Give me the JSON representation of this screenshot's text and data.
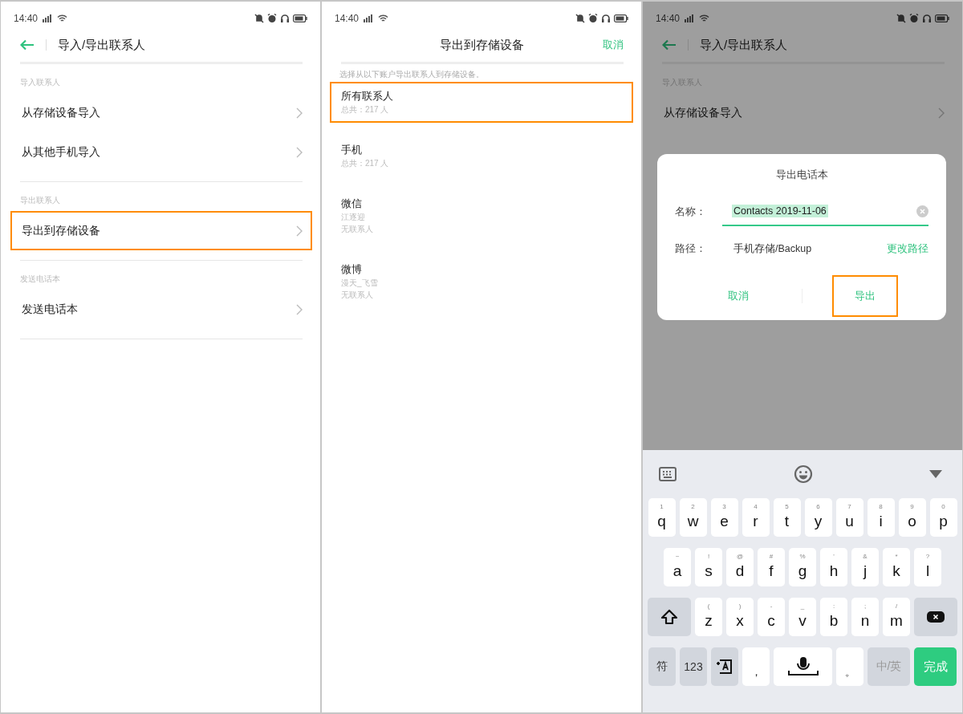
{
  "panels": [
    {
      "kind": "contacts",
      "status_bar": {
        "time": "14:40"
      },
      "header": {
        "title": "导入/导出联系人"
      },
      "sections": [
        {
          "label": "导入联系人",
          "items": [
            {
              "label": "从存储设备导入",
              "highlighted": false
            },
            {
              "label": "从其他手机导入",
              "highlighted": false
            }
          ]
        },
        {
          "label": "导出联系人",
          "items": [
            {
              "label": "导出到存储设备",
              "highlighted": true
            }
          ]
        },
        {
          "label": "发送电话本",
          "items": [
            {
              "label": "发送电话本",
              "highlighted": false
            }
          ]
        }
      ]
    },
    {
      "kind": "accounts",
      "status_bar": {
        "time": "14:40"
      },
      "header": {
        "title": "导出到存储设备",
        "action": "取消"
      },
      "hint": "选择从以下账户导出联系人到存储设备。",
      "accounts": [
        {
          "name": "所有联系人",
          "details": [
            "总共：217 人"
          ],
          "highlighted": true
        },
        {
          "name": "手机",
          "details": [
            "总共：217 人"
          ],
          "highlighted": false
        },
        {
          "name": "微信",
          "details": [
            "江逐迎",
            "无联系人"
          ],
          "highlighted": false
        },
        {
          "name": "微博",
          "details": [
            "漫天_飞雪",
            "无联系人"
          ],
          "highlighted": false
        }
      ]
    },
    {
      "kind": "export-dialog",
      "status_bar": {
        "time": "14:40"
      },
      "header": {
        "title": "导入/导出联系人"
      },
      "sections": [
        {
          "label": "导入联系人",
          "items": [
            {
              "label": "从存储设备导入",
              "highlighted": false
            }
          ]
        }
      ],
      "dialog": {
        "title": "导出电话本",
        "name_label": "名称：",
        "name_value": "Contacts 2019-11-06",
        "path_label": "路径：",
        "path_value": "手机存储/Backup",
        "change_path": "更改路径",
        "buttons": [
          {
            "label": "取消",
            "highlighted": false
          },
          {
            "label": "导出",
            "highlighted": true
          }
        ]
      },
      "keyboard": {
        "rows": [
          {
            "keys": [
              {
                "kind": "letter",
                "label": "q",
                "hint": "1"
              },
              {
                "kind": "letter",
                "label": "w",
                "hint": "2"
              },
              {
                "kind": "letter",
                "label": "e",
                "hint": "3"
              },
              {
                "kind": "letter",
                "label": "r",
                "hint": "4"
              },
              {
                "kind": "letter",
                "label": "t",
                "hint": "5"
              },
              {
                "kind": "letter",
                "label": "y",
                "hint": "6"
              },
              {
                "kind": "letter",
                "label": "u",
                "hint": "7"
              },
              {
                "kind": "letter",
                "label": "i",
                "hint": "8"
              },
              {
                "kind": "letter",
                "label": "o",
                "hint": "9"
              },
              {
                "kind": "letter",
                "label": "p",
                "hint": "0"
              }
            ]
          },
          {
            "keys": [
              {
                "kind": "letter",
                "label": "a",
                "hint": "~"
              },
              {
                "kind": "letter",
                "label": "s",
                "hint": "!"
              },
              {
                "kind": "letter",
                "label": "d",
                "hint": "@"
              },
              {
                "kind": "letter",
                "label": "f",
                "hint": "#"
              },
              {
                "kind": "letter",
                "label": "g",
                "hint": "%"
              },
              {
                "kind": "letter",
                "label": "h",
                "hint": "'"
              },
              {
                "kind": "letter",
                "label": "j",
                "hint": "&"
              },
              {
                "kind": "letter",
                "label": "k",
                "hint": "*"
              },
              {
                "kind": "letter",
                "label": "l",
                "hint": "?"
              }
            ]
          },
          {
            "keys": [
              {
                "kind": "shift"
              },
              {
                "kind": "letter",
                "label": "z",
                "hint": "("
              },
              {
                "kind": "letter",
                "label": "x",
                "hint": ")"
              },
              {
                "kind": "letter",
                "label": "c",
                "hint": "-"
              },
              {
                "kind": "letter",
                "label": "v",
                "hint": "_"
              },
              {
                "kind": "letter",
                "label": "b",
                "hint": ":"
              },
              {
                "kind": "letter",
                "label": "n",
                "hint": ";"
              },
              {
                "kind": "letter",
                "label": "m",
                "hint": "/"
              },
              {
                "kind": "backspace"
              }
            ]
          },
          {
            "keys": [
              {
                "kind": "function",
                "label": "符"
              },
              {
                "kind": "function",
                "label": "123"
              },
              {
                "kind": "layout"
              },
              {
                "kind": "punct",
                "label": "，"
              },
              {
                "kind": "space"
              },
              {
                "kind": "punct",
                "label": "。"
              },
              {
                "kind": "function",
                "label": "中/英"
              },
              {
                "kind": "done",
                "label": "完成"
              }
            ]
          }
        ]
      }
    }
  ]
}
